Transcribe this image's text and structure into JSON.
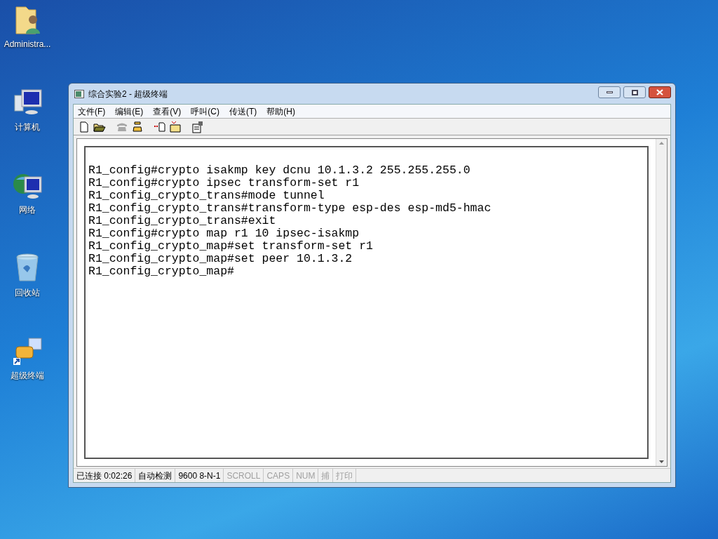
{
  "desktop_icons": [
    {
      "kind": "user-folder",
      "label": "Administra..."
    },
    {
      "kind": "computer",
      "label": "计算机"
    },
    {
      "kind": "network",
      "label": "网络"
    },
    {
      "kind": "recycle-bin",
      "label": "回收站"
    },
    {
      "kind": "terminal-shortcut",
      "label": "超级终端"
    }
  ],
  "window": {
    "title": "综合实验2 - 超级终端"
  },
  "menu": [
    "文件(F)",
    "编辑(E)",
    "查看(V)",
    "呼叫(C)",
    "传送(T)",
    "帮助(H)"
  ],
  "toolbar": [
    {
      "kind": "new",
      "disabled": false
    },
    {
      "kind": "open",
      "disabled": false
    },
    {
      "kind": "call",
      "disabled": true
    },
    {
      "kind": "hangup",
      "disabled": false
    },
    {
      "kind": "send",
      "disabled": false
    },
    {
      "kind": "receive",
      "disabled": false
    },
    {
      "kind": "properties",
      "disabled": false
    }
  ],
  "terminal": {
    "lines": [
      "R1_config#crypto isakmp key dcnu 10.1.3.2 255.255.255.0",
      "R1_config#crypto ipsec transform-set r1",
      "R1_config_crypto_trans#mode tunnel",
      "R1_config_crypto_trans#transform-type esp-des esp-md5-hmac",
      "R1_config_crypto_trans#exit",
      "R1_config#crypto map r1 10 ipsec-isakmp",
      "R1_config_crypto_map#set transform-set r1",
      "R1_config_crypto_map#set peer 10.1.3.2",
      "R1_config_crypto_map#"
    ]
  },
  "status_bar": [
    {
      "text": "已连接 0:02:26",
      "active": true
    },
    {
      "text": "自动检测",
      "active": true
    },
    {
      "text": "9600 8-N-1",
      "active": true
    },
    {
      "text": "SCROLL",
      "active": false
    },
    {
      "text": "CAPS",
      "active": false
    },
    {
      "text": "NUM",
      "active": false
    },
    {
      "text": "捕",
      "active": false
    },
    {
      "text": "打印",
      "active": false
    }
  ]
}
